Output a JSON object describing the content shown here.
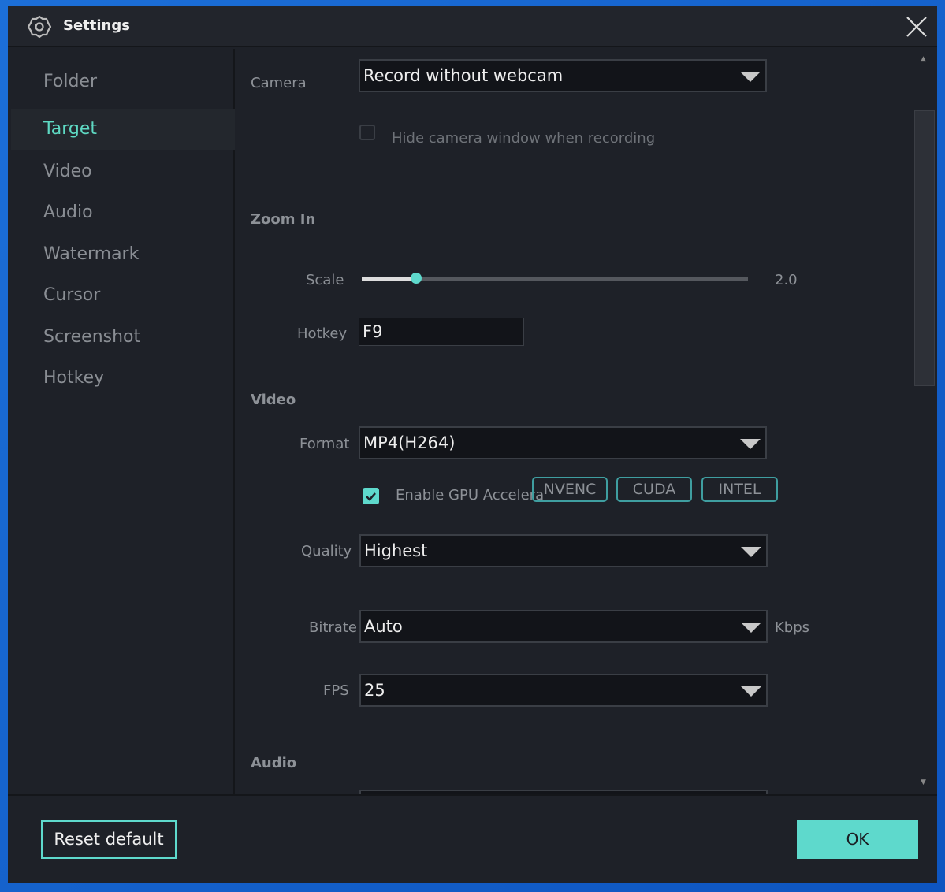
{
  "window": {
    "title": "Settings"
  },
  "sidebar": {
    "items": [
      {
        "label": "Folder"
      },
      {
        "label": "Target",
        "selected": true
      },
      {
        "label": "Video"
      },
      {
        "label": "Audio"
      },
      {
        "label": "Watermark"
      },
      {
        "label": "Cursor"
      },
      {
        "label": "Screenshot"
      },
      {
        "label": "Hotkey"
      }
    ]
  },
  "camera": {
    "label": "Camera",
    "value": "Record without webcam",
    "hide_label": "Hide camera window when recording",
    "hide_checked": false
  },
  "zoom": {
    "section": "Zoom In",
    "scale_label": "Scale",
    "scale_value": "2.0",
    "scale_fraction": 0.14,
    "hotkey_label": "Hotkey",
    "hotkey_value": "F9"
  },
  "video": {
    "section": "Video",
    "format_label": "Format",
    "format_value": "MP4(H264)",
    "gpu_label": "Enable GPU Accelera",
    "gpu_checked": true,
    "gpu_options": [
      "NVENC",
      "CUDA",
      "INTEL"
    ],
    "quality_label": "Quality",
    "quality_value": "Highest",
    "bitrate_label": "Bitrate",
    "bitrate_value": "Auto",
    "bitrate_unit": "Kbps",
    "fps_label": "FPS",
    "fps_value": "25"
  },
  "audio": {
    "section": "Audio"
  },
  "footer": {
    "reset": "Reset default",
    "ok": "OK"
  },
  "colors": {
    "accent": "#5ed9cc",
    "background": "#1e2128"
  }
}
